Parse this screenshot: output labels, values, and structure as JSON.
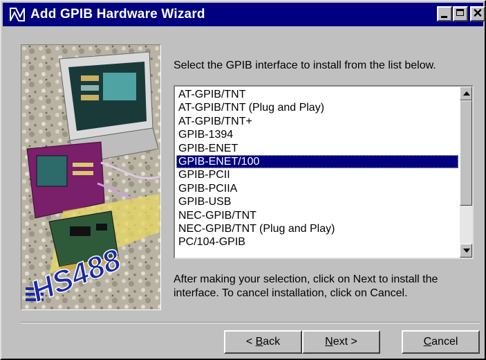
{
  "window": {
    "title": "Add GPIB Hardware Wizard",
    "accent": "#000080",
    "face": "#c0c0c0"
  },
  "titlebar_buttons": {
    "minimize": "minimize-icon",
    "maximize": "maximize-icon",
    "close_glyph": "✕"
  },
  "prompt": "Select the GPIB interface to install from the list below.",
  "list": {
    "items": [
      "AT-GPIB/TNT",
      "AT-GPIB/TNT (Plug and Play)",
      "AT-GPIB/TNT+",
      "GPIB-1394",
      "GPIB-ENET",
      "GPIB-ENET/100",
      "GPIB-PCII",
      "GPIB-PCIIA",
      "GPIB-USB",
      "NEC-GPIB/TNT",
      "NEC-GPIB/TNT (Plug and Play)",
      "PC/104-GPIB"
    ],
    "selected": "GPIB-ENET/100"
  },
  "help_text": "After making your selection, click on Next to install the interface.  To cancel installation, click on Cancel.",
  "art": {
    "logo_text": "HS488"
  },
  "buttons": {
    "back": {
      "pre": "< ",
      "key": "B",
      "post": "ack"
    },
    "next": {
      "pre": "",
      "key": "N",
      "post": "ext >"
    },
    "cancel": {
      "pre": "",
      "key": "C",
      "post": "ancel"
    }
  }
}
